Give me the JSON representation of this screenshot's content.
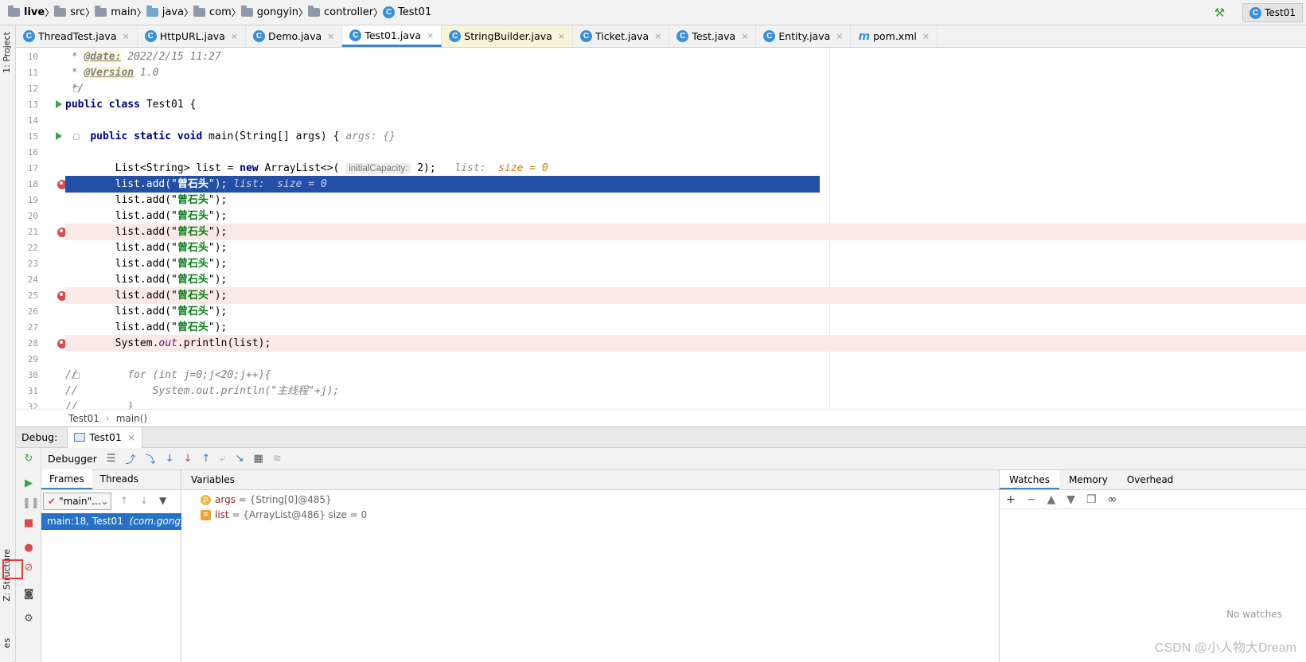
{
  "breadcrumb": [
    "live",
    "src",
    "main",
    "java",
    "com",
    "gongyin",
    "controller",
    "Test01"
  ],
  "run_config": "Test01",
  "tabs": [
    {
      "label": "ThreadTest.java",
      "icon": "C",
      "cls": ""
    },
    {
      "label": "HttpURL.java",
      "icon": "C",
      "cls": ""
    },
    {
      "label": "Demo.java",
      "icon": "C",
      "cls": ""
    },
    {
      "label": "Test01.java",
      "icon": "C",
      "cls": "active"
    },
    {
      "label": "StringBuilder.java",
      "icon": "C",
      "cls": "sb"
    },
    {
      "label": "Ticket.java",
      "icon": "C",
      "cls": ""
    },
    {
      "label": "Test.java",
      "icon": "C",
      "cls": ""
    },
    {
      "label": "Entity.java",
      "icon": "C",
      "cls": ""
    },
    {
      "label": "pom.xml",
      "icon": "m",
      "cls": ""
    }
  ],
  "side": {
    "project": "1: Project",
    "structure": "Z: Structure",
    "fav": "es"
  },
  "code": [
    {
      "n": "10",
      "html": "<span class=\"cmt\"> * <span class=\"tag\">@date:</span> 2022/2/15 11:27</span>"
    },
    {
      "n": "11",
      "html": "<span class=\"cmt\"> * <span class=\"tag\">@Version</span> 1.0</span>"
    },
    {
      "n": "12",
      "html": "<span class=\"cmt\"> */</span>",
      "fold": true
    },
    {
      "n": "13",
      "html": "<span class=\"kw\">public class</span> Test01 {",
      "run": true
    },
    {
      "n": "14",
      "html": ""
    },
    {
      "n": "15",
      "html": "    <span class=\"kw\">public static void</span> main(String[] args) {<span class=\"hint\">args: {}</span>",
      "run": true,
      "fold": true
    },
    {
      "n": "16",
      "html": ""
    },
    {
      "n": "17",
      "html": "        List&lt;String&gt; list = <span class=\"kw\">new</span> ArrayList&lt;&gt;( <span class=\"inlay\">initialCapacity:</span> 2);  <span class=\"hint\">list:  </span><span class=\"hint2\">size = 0</span>"
    },
    {
      "n": "18",
      "html": "        list.add(\"<span class=\"str\">曾石头</span>\");<span class=\"hint\" style=\"color:#c8d4f0\">list:  size = 0</span>",
      "bp": true,
      "cur": true
    },
    {
      "n": "19",
      "html": "        list.add(\"<span class=\"str\">曾石头</span>\");"
    },
    {
      "n": "20",
      "html": "        list.add(\"<span class=\"str\">曾石头</span>\");"
    },
    {
      "n": "21",
      "html": "        list.add(\"<span class=\"str\">曾石头</span>\");",
      "bp": true
    },
    {
      "n": "22",
      "html": "        list.add(\"<span class=\"str\">曾石头</span>\");"
    },
    {
      "n": "23",
      "html": "        list.add(\"<span class=\"str\">曾石头</span>\");"
    },
    {
      "n": "24",
      "html": "        list.add(\"<span class=\"str\">曾石头</span>\");"
    },
    {
      "n": "25",
      "html": "        list.add(\"<span class=\"str\">曾石头</span>\");",
      "bp": true
    },
    {
      "n": "26",
      "html": "        list.add(\"<span class=\"str\">曾石头</span>\");"
    },
    {
      "n": "27",
      "html": "        list.add(\"<span class=\"str\">曾石头</span>\");"
    },
    {
      "n": "28",
      "html": "        System.<span style=\"color:#660e7a;font-style:italic\">out</span>.println(list);",
      "bp": true
    },
    {
      "n": "29",
      "html": ""
    },
    {
      "n": "30",
      "html": "<span class=\"cmt\">//        for (int j=0;j&lt;20;j++){</span>",
      "fold": true
    },
    {
      "n": "31",
      "html": "<span class=\"cmt\">//            System.out.println(\"主线程\"+j);</span>"
    },
    {
      "n": "32",
      "html": "<span class=\"cmt\">//        }</span>"
    }
  ],
  "editor_crumb": [
    "Test01",
    "main()"
  ],
  "debug": {
    "label": "Debug:",
    "tab": "Test01",
    "debugger": "Debugger",
    "frames": "Frames",
    "threads": "Threads",
    "thread_sel": "\"main\"...",
    "frame": "main:18, Test01",
    "frame_pkg": "(com.gongyin",
    "variables": "Variables"
  },
  "variables": [
    {
      "icon": "p",
      "name": "args",
      "val": " = {String[0]@485}"
    },
    {
      "icon": "≡",
      "name": "list",
      "val": " = {ArrayList@486}  size = 0"
    }
  ],
  "watches": {
    "tabs": [
      "Watches",
      "Memory",
      "Overhead"
    ],
    "empty": "No watches"
  },
  "watermark": "CSDN @小人物大Dream"
}
